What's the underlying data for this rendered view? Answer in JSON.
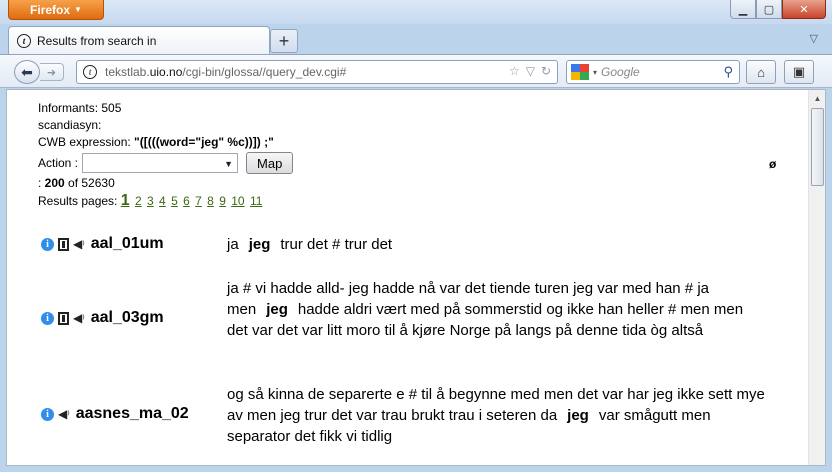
{
  "browser": {
    "app_button": "Firefox",
    "tab_title": "Results from search in",
    "url_prefix": "tekstlab.",
    "url_host": "uio.no",
    "url_path": "/cgi-bin/glossa//query_dev.cgi#",
    "search_placeholder": "Google"
  },
  "meta": {
    "informants": "Informants: 505",
    "corpus": "scandiasyn:",
    "cwb_label": "CWB expression: ",
    "cwb_value": "\"([(((word=\"jeg\" %c))]) ;\"",
    "action_label": "Action :",
    "map_button": "Map",
    "count_prefix": ": ",
    "count_shown": "200",
    "count_suffix": " of 52630",
    "pages_label": "Results pages:",
    "pages": [
      "1",
      "2",
      "3",
      "4",
      "5",
      "6",
      "7",
      "8",
      "9",
      "10",
      "11"
    ],
    "right_symbol": "ø"
  },
  "results": [
    {
      "id": "aal_01um",
      "before": "ja",
      "keyword": "jeg",
      "after": "trur det # trur det",
      "has_video": true
    },
    {
      "id": "aal_03gm",
      "before": "ja # vi hadde alld- jeg hadde nå var det tiende turen jeg var med han # ja men",
      "keyword": "jeg",
      "after": "hadde aldri vært med på sommerstid og ikke han heller # men men det var det var litt moro til å kjøre Norge på langs på denne tida òg altså",
      "has_video": true
    },
    {
      "id": "aasnes_ma_02",
      "before": "og så kinna de separerte e # til å begynne med men det var har jeg ikke sett mye av men jeg trur det var trau brukt trau i seteren da",
      "keyword": "jeg",
      "after": "var smågutt men separator det fikk vi tidlig",
      "has_video": false
    }
  ],
  "colors": {
    "link": "#3a6a13",
    "info_icon": "#2f8ee8",
    "firefox_orange": "#e06b10"
  }
}
